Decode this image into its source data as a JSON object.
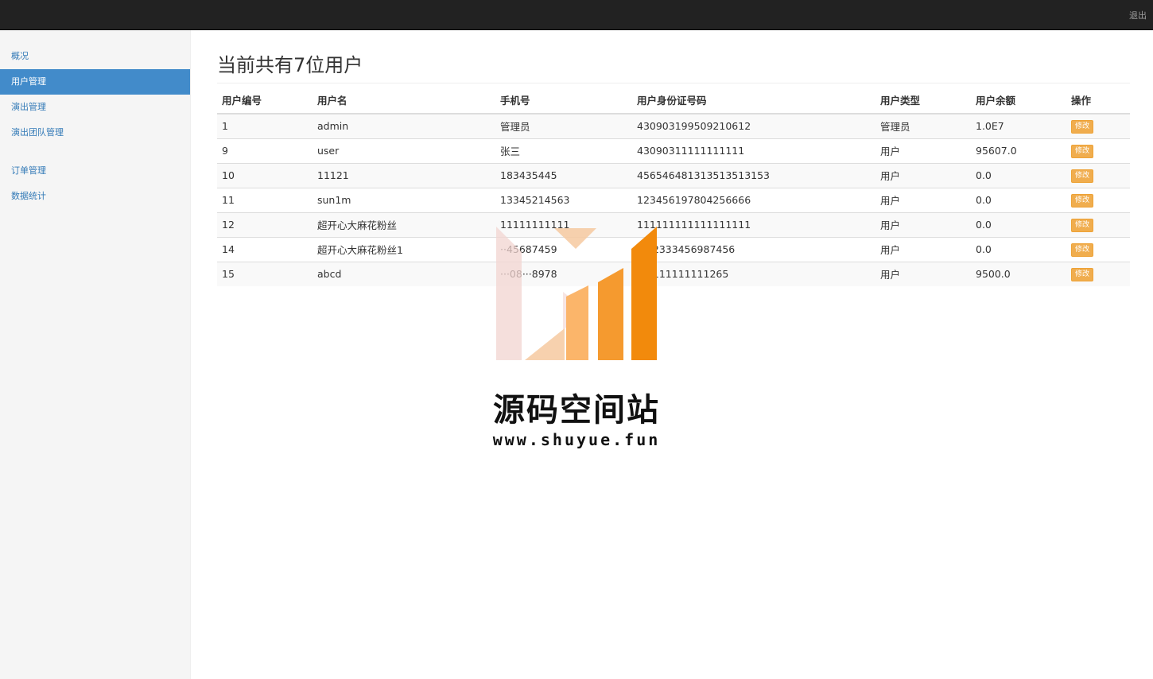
{
  "header": {
    "logout_label": "退出"
  },
  "sidebar": {
    "items": [
      {
        "label": "概况",
        "active": false
      },
      {
        "label": "用户管理",
        "active": true
      },
      {
        "label": "演出管理",
        "active": false
      },
      {
        "label": "演出团队管理",
        "active": false
      },
      {
        "label": "订单管理",
        "active": false
      },
      {
        "label": "数据统计",
        "active": false
      }
    ]
  },
  "main": {
    "title": "当前共有7位用户",
    "table": {
      "headers": [
        "用户编号",
        "用户名",
        "手机号",
        "用户身份证号码",
        "用户类型",
        "用户余额",
        "操作"
      ],
      "action_label": "修改",
      "rows": [
        [
          "1",
          "admin",
          "管理员",
          "430903199509210612",
          "管理员",
          "1.0E7"
        ],
        [
          "9",
          "user",
          "张三",
          "43090311111111111",
          "用户",
          "95607.0"
        ],
        [
          "10",
          "11121",
          "183435445",
          "456546481313513513153",
          "用户",
          "0.0"
        ],
        [
          "11",
          "sun1m",
          "13345214563",
          "123456197804256666",
          "用户",
          "0.0"
        ],
        [
          "12",
          "超开心大麻花粉丝",
          "11111111111",
          "111111111111111111",
          "用户",
          "0.0"
        ],
        [
          "14",
          "超开心大麻花粉丝1",
          "··45687459",
          "···22333456987456",
          "用户",
          "0.0"
        ],
        [
          "15",
          "abcd",
          "···08···8978",
          "·11111111111265",
          "用户",
          "9500.0"
        ]
      ]
    }
  },
  "watermark": {
    "title": "源码空间站",
    "url": "www.shuyue.fun",
    "colors": {
      "light": "#f2d4d0",
      "peach": "#f6c9a0",
      "orange_light": "#fbb56a",
      "orange": "#f59a2f",
      "orange_dark": "#f28a0c"
    }
  },
  "colors": {
    "topbar": "#222222",
    "sidebar_bg": "#f5f5f5",
    "active_nav": "#428bca",
    "link": "#337ab7",
    "edit_button": "#f0ad4e"
  }
}
